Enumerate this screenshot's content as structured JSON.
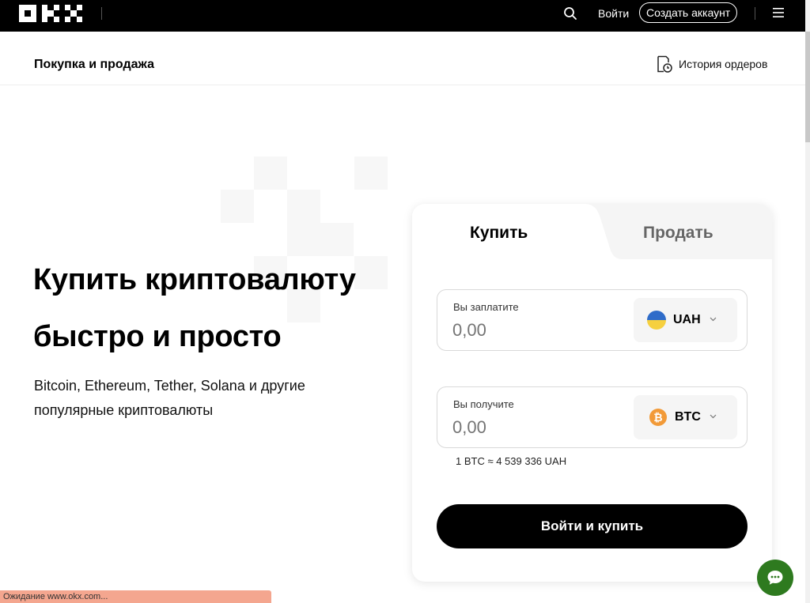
{
  "header": {
    "logo_text": "OKX",
    "search_icon": "search-icon",
    "login_label": "Войти",
    "signup_label": "Создать аккаунт",
    "menu_icon": "hamburger-menu-icon"
  },
  "subheader": {
    "title": "Покупка и продажа",
    "history_label": "История ордеров",
    "history_icon": "order-history-icon"
  },
  "hero": {
    "title_line1": "Купить криптовалюту",
    "title_line2": "быстро и просто",
    "subtitle_line1": "Bitcoin, Ethereum, Tether, Solana и другие",
    "subtitle_line2": "популярные криптовалюты"
  },
  "trade": {
    "tabs": [
      {
        "label": "Купить",
        "active": true
      },
      {
        "label": "Продать",
        "active": false
      }
    ],
    "pay": {
      "label": "Вы заплатите",
      "placeholder": "0,00",
      "currency": "UAH",
      "currency_icon": "ukraine-flag-icon"
    },
    "receive": {
      "label": "Вы получите",
      "placeholder": "0,00",
      "currency": "BTC",
      "currency_icon": "bitcoin-icon"
    },
    "rate": "1 BTC ≈ 4 539 336 UAH",
    "cta_label": "Войти и купить"
  },
  "chat": {
    "icon": "chat-bubble-icon"
  },
  "status_bar": {
    "text": "Ожидание www.okx.com..."
  },
  "colors": {
    "topbar": "#000000",
    "chat": "#2e7a1f",
    "btc": "#f29a38",
    "status_bar": "#f4a68f"
  }
}
